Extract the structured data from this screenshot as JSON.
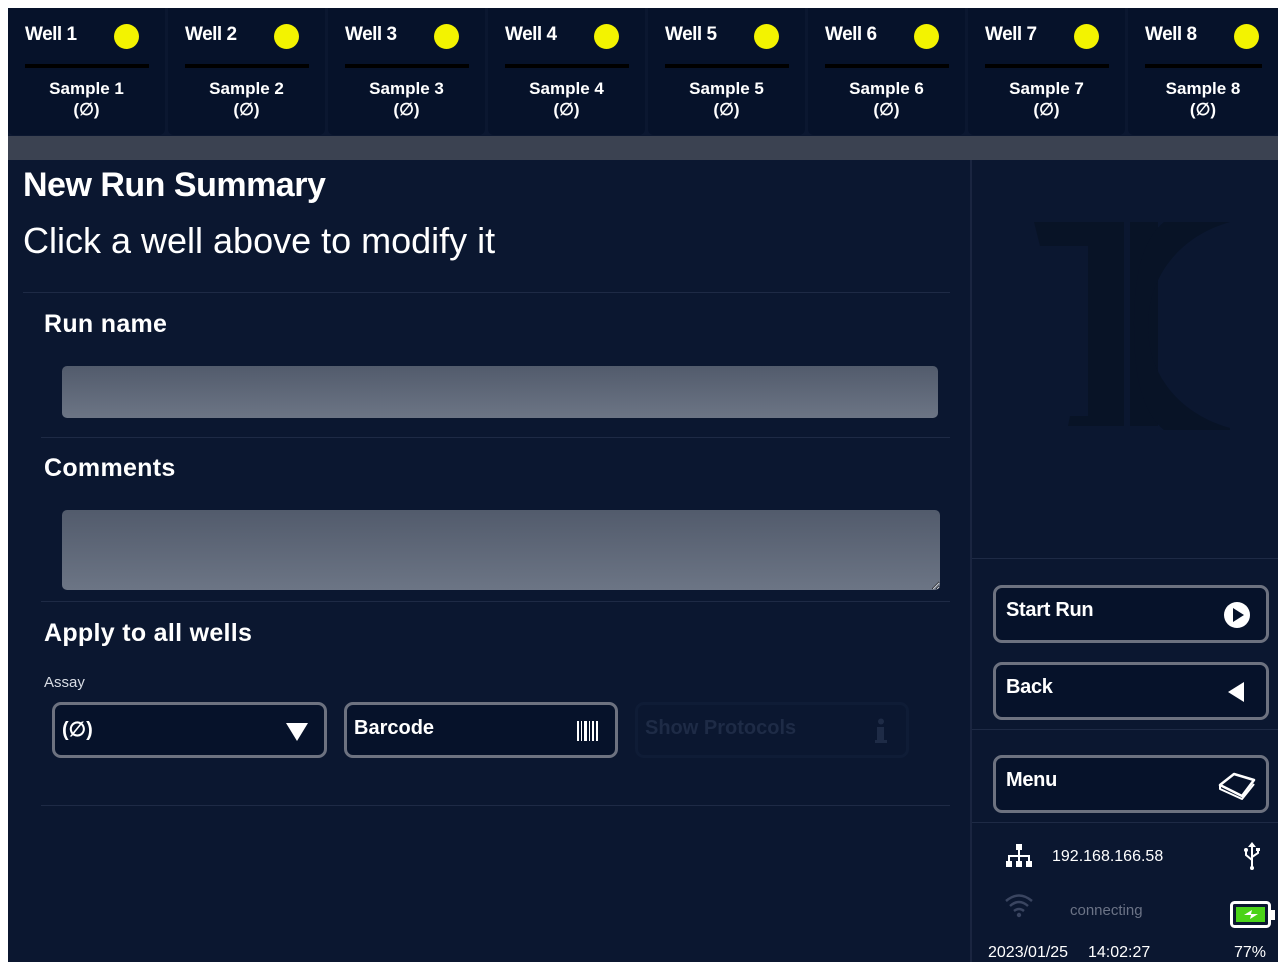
{
  "wells": [
    {
      "name": "Well 1",
      "sample": "Sample 1",
      "value": "(∅)"
    },
    {
      "name": "Well 2",
      "sample": "Sample 2",
      "value": "(∅)"
    },
    {
      "name": "Well 3",
      "sample": "Sample 3",
      "value": "(∅)"
    },
    {
      "name": "Well 4",
      "sample": "Sample 4",
      "value": "(∅)"
    },
    {
      "name": "Well 5",
      "sample": "Sample 5",
      "value": "(∅)"
    },
    {
      "name": "Well 6",
      "sample": "Sample 6",
      "value": "(∅)"
    },
    {
      "name": "Well 7",
      "sample": "Sample 7",
      "value": "(∅)"
    },
    {
      "name": "Well 8",
      "sample": "Sample 8",
      "value": "(∅)"
    }
  ],
  "colors": {
    "background": "#0b1730",
    "well_indicator": "#f3f300",
    "battery": "#4ad318"
  },
  "main": {
    "title": "New Run Summary",
    "subtitle": "Click a well above to modify it",
    "run_name_label": "Run name",
    "run_name_value": "",
    "comments_label": "Comments",
    "comments_value": "",
    "apply_label": "Apply to all wells",
    "assay_label": "Assay",
    "assay_value": "(∅)",
    "barcode_label": "Barcode",
    "show_protocols_label": "Show Protocols"
  },
  "side": {
    "start_run_label": "Start Run",
    "back_label": "Back",
    "menu_label": "Menu"
  },
  "status": {
    "ip": "192.168.166.58",
    "wifi_text": "connecting",
    "date": "2023/01/25",
    "time": "14:02:27",
    "battery": "77%"
  }
}
